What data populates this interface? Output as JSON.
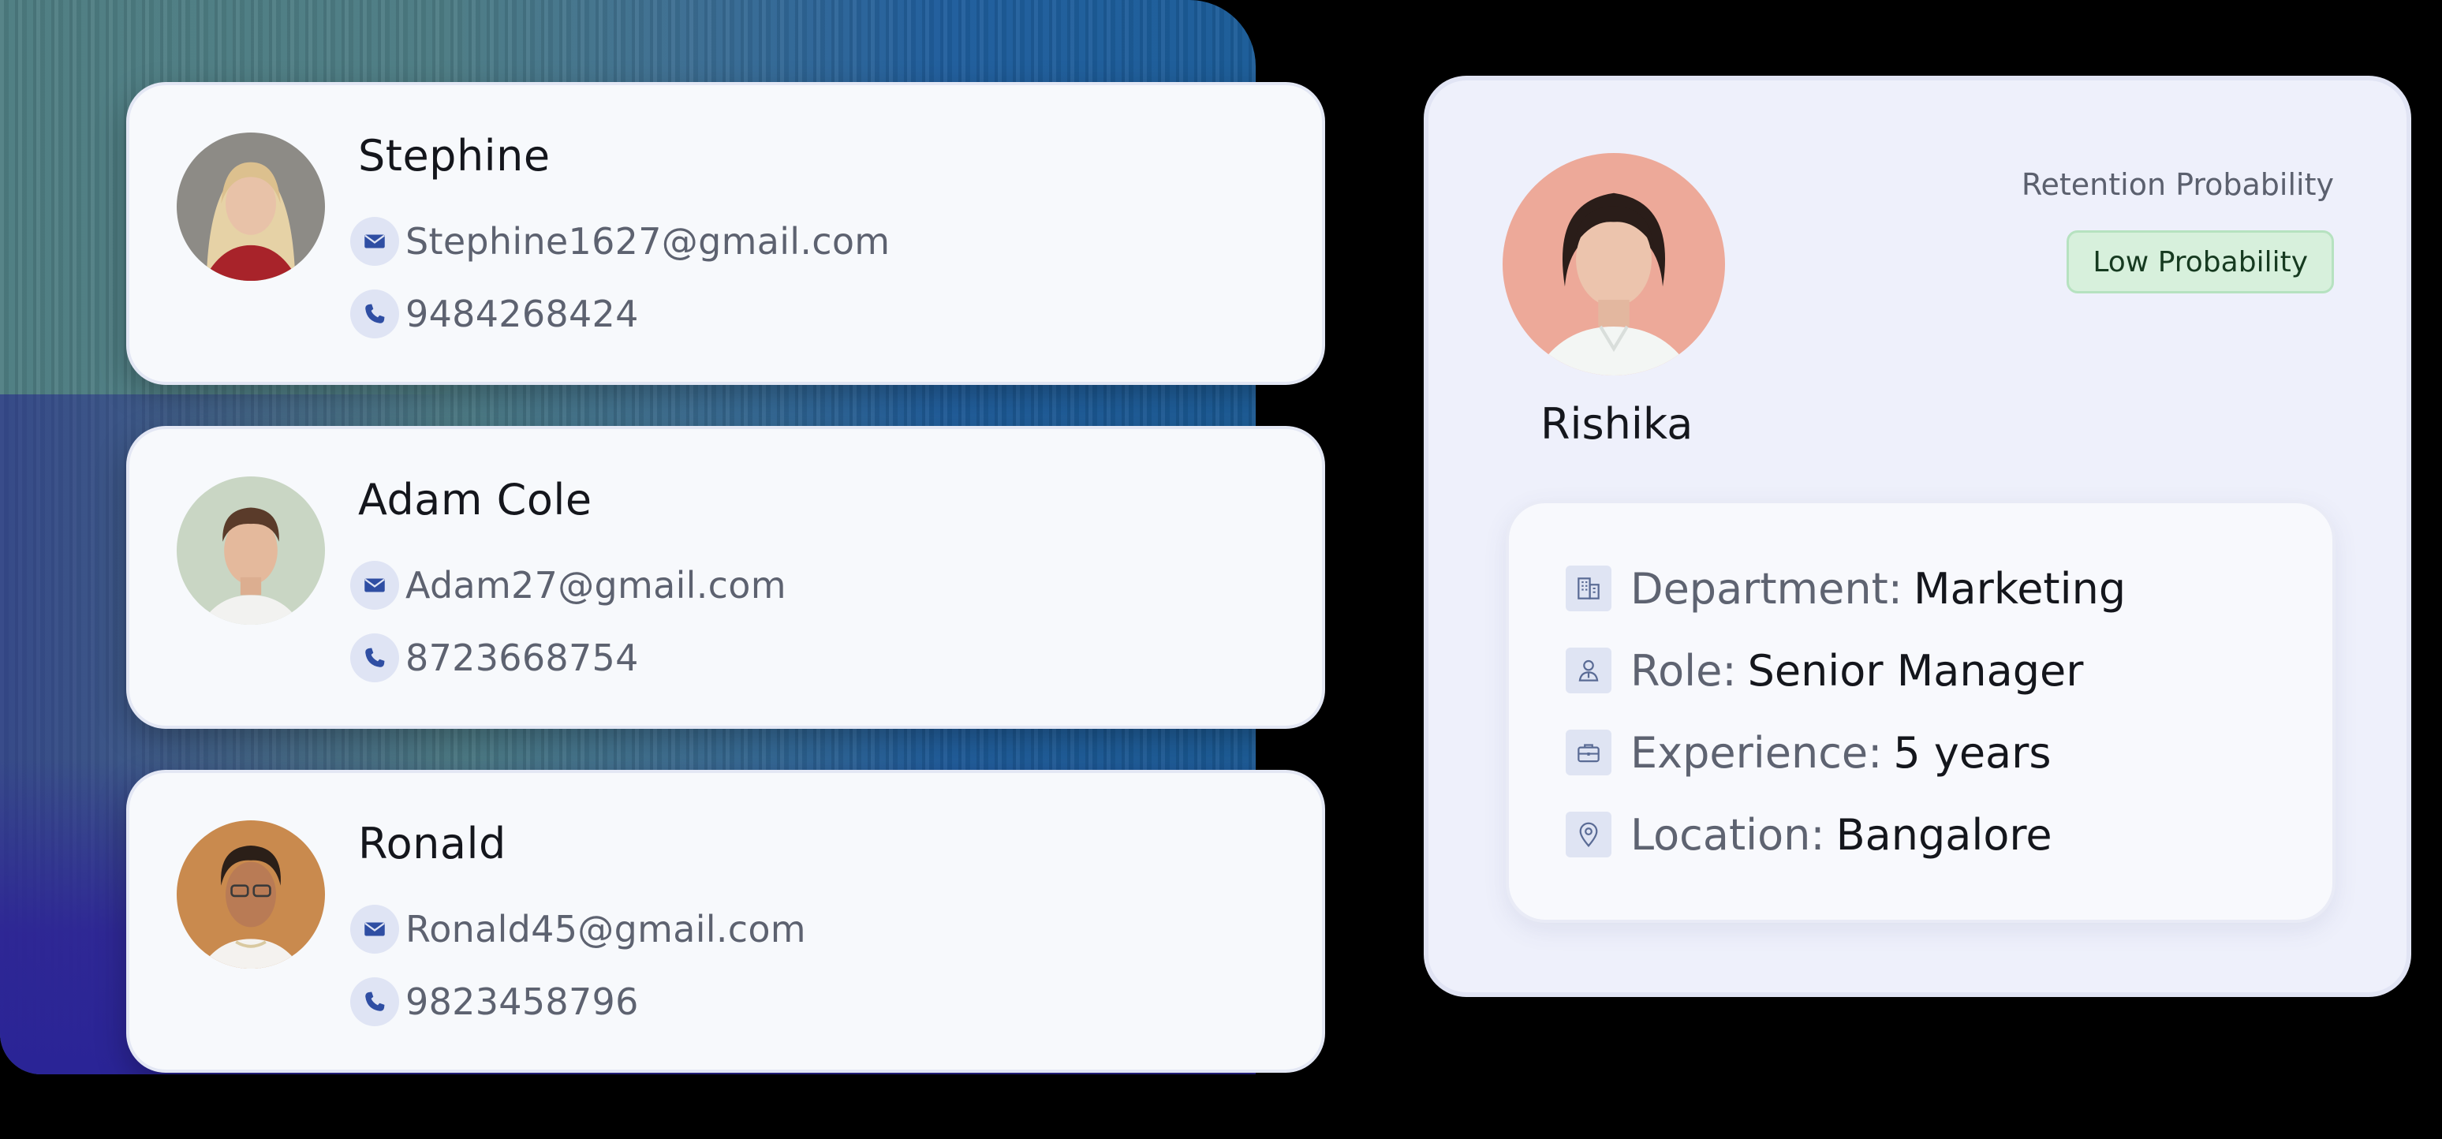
{
  "contacts": [
    {
      "name": "Stephine",
      "email": "Stephine1627@gmail.com",
      "phone": "9484268424"
    },
    {
      "name": "Adam Cole",
      "email": "Adam27@gmail.com",
      "phone": "8723668754"
    },
    {
      "name": "Ronald",
      "email": "Ronald45@gmail.com",
      "phone": "9823458796"
    }
  ],
  "profile": {
    "name": "Rishika",
    "retention_label": "Retention Probability",
    "retention_badge": "Low Probability",
    "details": [
      {
        "icon": "building-icon",
        "label": "Department:",
        "value": "Marketing"
      },
      {
        "icon": "user-role-icon",
        "label": "Role:",
        "value": "Senior Manager"
      },
      {
        "icon": "briefcase-icon",
        "label": "Experience:",
        "value": "5 years"
      },
      {
        "icon": "location-pin-icon",
        "label": "Location:",
        "value": "Bangalore"
      }
    ]
  },
  "colors": {
    "badge_bg": "#d7f0dc",
    "badge_text": "#163a20",
    "icon_accent": "#2f4ea3"
  }
}
